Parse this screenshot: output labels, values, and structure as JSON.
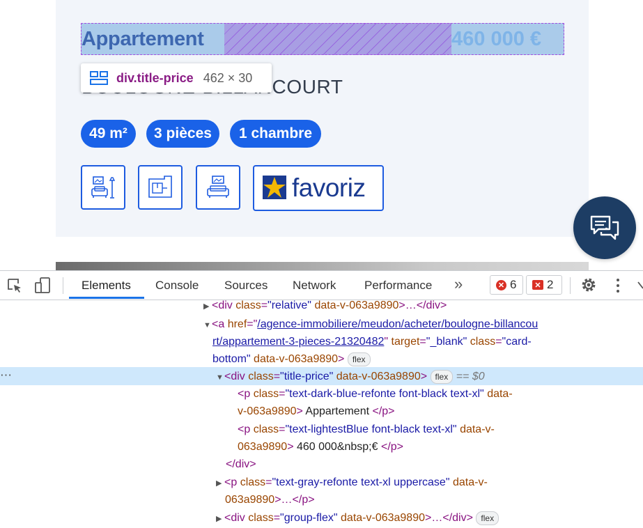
{
  "page": {
    "listing_type": "Appartement",
    "price": "460 000 €",
    "city": "BOULOGNE-BILLANCOURT",
    "chips": [
      "49 m²",
      "3 pièces",
      "1 chambre"
    ],
    "favoriz_label": "favoriz",
    "inspector_tooltip": {
      "selector": "div.title-price",
      "size": "462 × 30"
    }
  },
  "devtools": {
    "tabs": [
      "Elements",
      "Console",
      "Sources",
      "Network",
      "Performance"
    ],
    "more_tabs": "»",
    "active_tab": "Elements",
    "error_count": "6",
    "issue_count": "2",
    "row_menu": "⋯"
  },
  "dom": {
    "l1": {
      "open": "<div ",
      "a1": "class",
      "v1": "\"relative\"",
      "a2": "data-v-063a9890",
      "close": ">…</div>"
    },
    "l2": {
      "open": "<a ",
      "a1": "href",
      "eq": "=\"",
      "href1": "/agence-immobiliere/meudon/acheter/boulogne-billancou"
    },
    "l3": {
      "href2": "rt/appartement-3-pieces-21320482",
      "q": "\" ",
      "a2": "target",
      "v2": "\"_blank\"",
      "a3": "class",
      "v3a": "\"card-"
    },
    "l4": {
      "v3b": "bottom\"",
      "a4": "data-v-063a9890",
      "close": ">",
      "pill": "flex"
    },
    "l5": {
      "open": "<div ",
      "a1": "class",
      "v1": "\"title-price\"",
      "a2": "data-v-063a9890",
      "close": ">",
      "pill": "flex",
      "eq0": "== $0"
    },
    "l6": {
      "open": "<p ",
      "a1": "class",
      "v1": "\"text-dark-blue-refonte font-black text-xl\"",
      "a2": "data-"
    },
    "l7": {
      "a2b": "v-063a9890",
      "close": ">",
      "text": " Appartement ",
      "end": "</p>"
    },
    "l8": {
      "open": "<p ",
      "a1": "class",
      "v1": "\"text-lightestBlue font-black text-xl\"",
      "a2": "data-v-"
    },
    "l9": {
      "a2b": "063a9890",
      "close": ">",
      "text": " 460 000&nbsp;€ ",
      "end": "</p>"
    },
    "l10": {
      "end": "</div>"
    },
    "l11": {
      "open": "<p ",
      "a1": "class",
      "v1": "\"text-gray-refonte text-xl uppercase\"",
      "a2": "data-v-"
    },
    "l12": {
      "a2b": "063a9890",
      "close": ">…</p>"
    },
    "l13": {
      "open": "<div ",
      "a1": "class",
      "v1": "\"group-flex\"",
      "a2": "data-v-063a9890",
      "close": ">…</div>",
      "pill": "flex"
    }
  }
}
